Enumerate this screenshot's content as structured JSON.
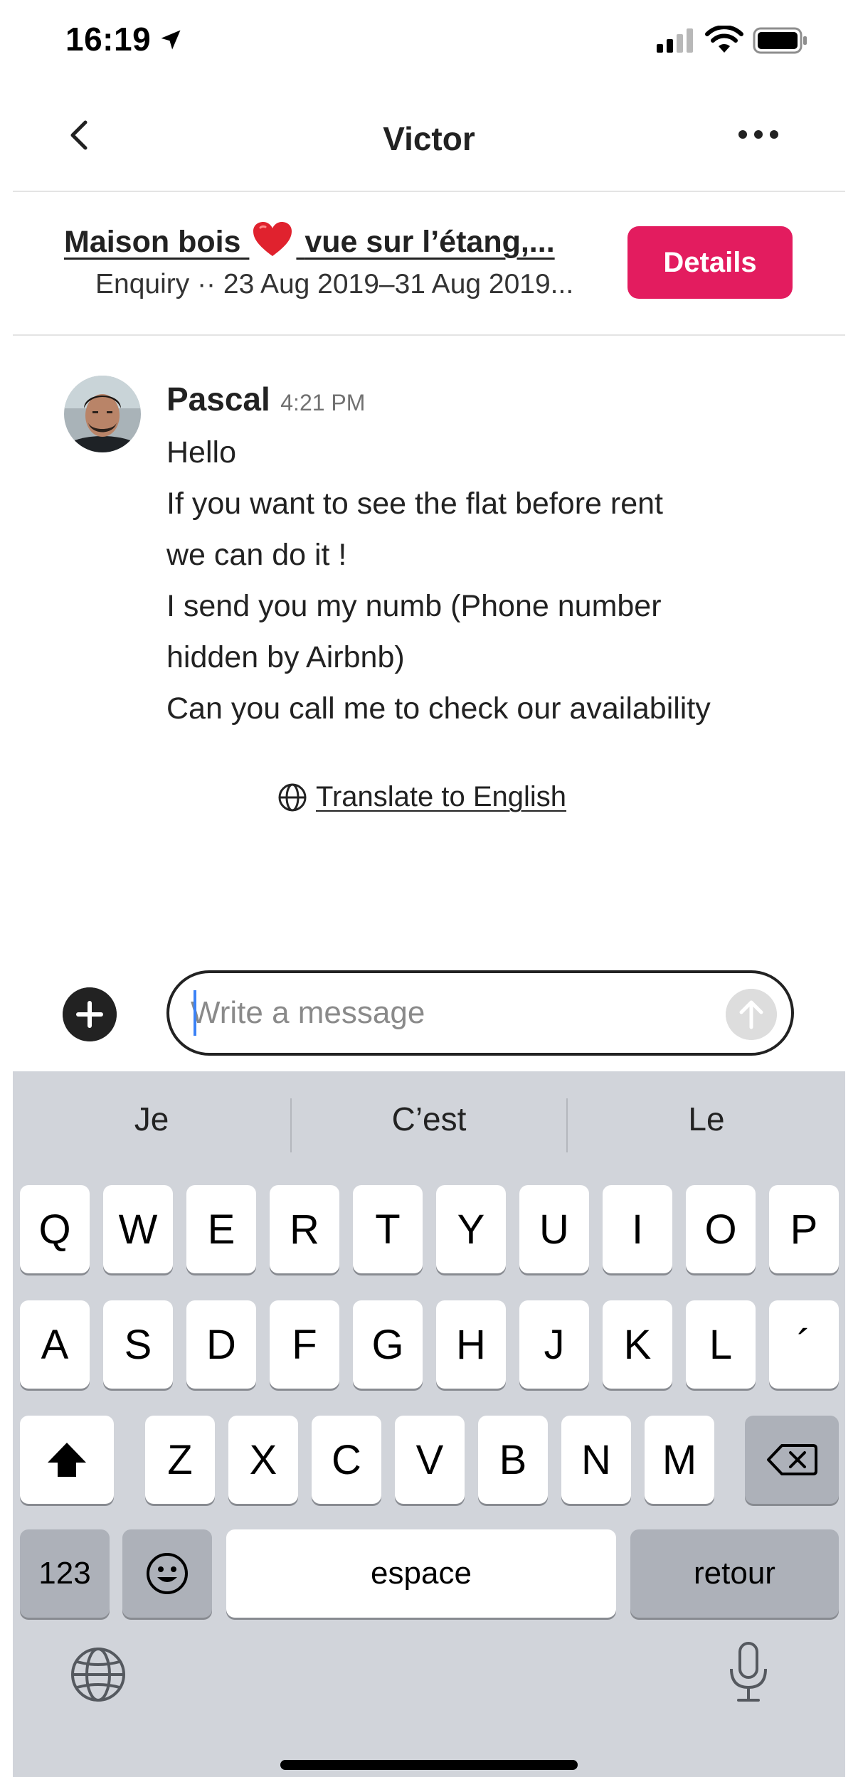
{
  "status_bar": {
    "time": "16:19"
  },
  "header": {
    "title": "Victor"
  },
  "listing": {
    "title_part1": "Maison bois",
    "title_part2": "vue sur l’étang,...",
    "subtitle": "Enquiry ·· 23 Aug 2019–31 Aug 2019...",
    "details_label": "Details",
    "accent_color": "#e31c5f"
  },
  "message": {
    "sender": "Pascal",
    "time": "4:21 PM",
    "lines": [
      "Hello",
      "If you want to see the flat before rent",
      "we can do it !",
      "I send you my numb (Phone number",
      "hidden by Airbnb)",
      "Can you call me to check our availability"
    ]
  },
  "translate": {
    "label": "Translate to English"
  },
  "composer": {
    "placeholder": "Write a message"
  },
  "keyboard": {
    "suggestions": [
      "Je",
      "C’est",
      "Le"
    ],
    "row1": [
      "Q",
      "W",
      "E",
      "R",
      "T",
      "Y",
      "U",
      "I",
      "O",
      "P"
    ],
    "row2": [
      "A",
      "S",
      "D",
      "F",
      "G",
      "H",
      "J",
      "K",
      "L",
      "´"
    ],
    "row3": [
      "Z",
      "X",
      "C",
      "V",
      "B",
      "N",
      "M"
    ],
    "numbers_label": "123",
    "space_label": "espace",
    "return_label": "retour",
    "icons": [
      "shift-icon",
      "delete-icon",
      "emoji-icon",
      "globe-icon",
      "microphone-icon"
    ]
  }
}
